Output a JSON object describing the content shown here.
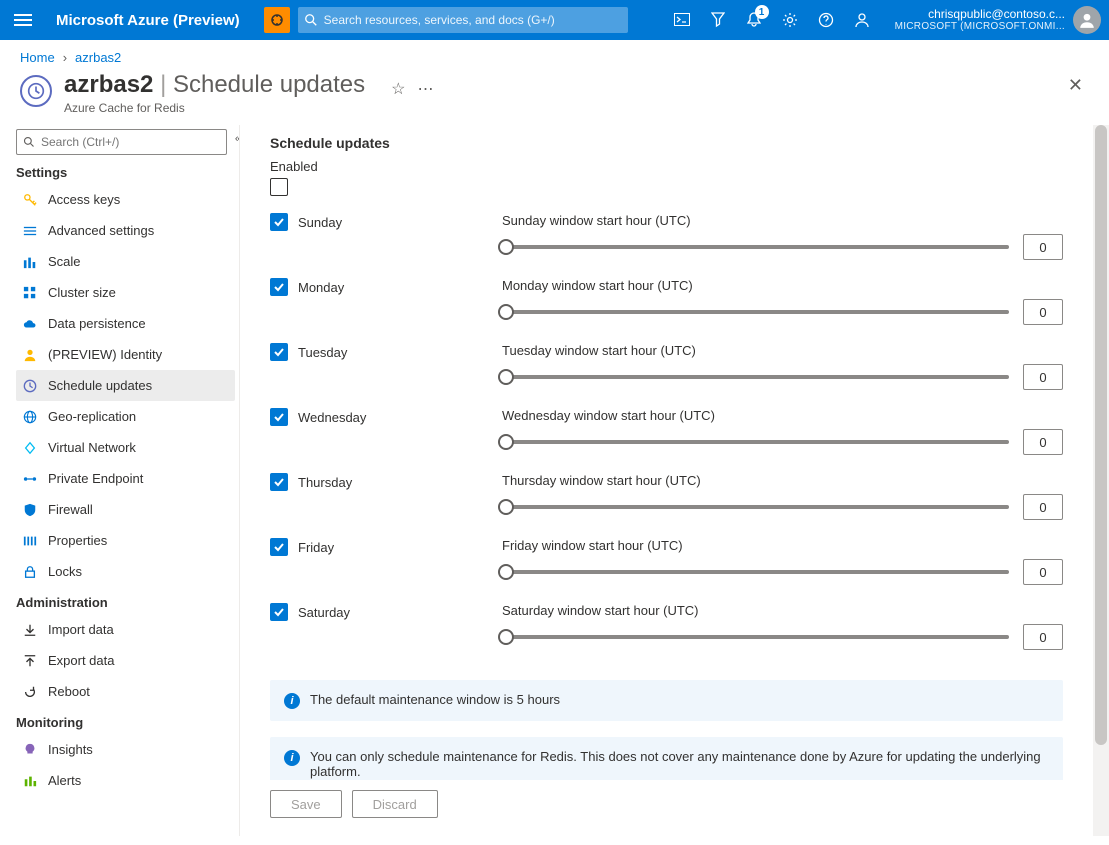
{
  "topbar": {
    "brand": "Microsoft Azure (Preview)",
    "search_placeholder": "Search resources, services, and docs (G+/)",
    "notification_count": "1",
    "account_email": "chrisqpublic@contoso.c...",
    "account_org": "MICROSOFT (MICROSOFT.ONMI..."
  },
  "breadcrumb": {
    "home": "Home",
    "resource": "azrbas2"
  },
  "header": {
    "resource_name": "azrbas2",
    "blade_title": "Schedule updates",
    "resource_type": "Azure Cache for Redis"
  },
  "sidebar": {
    "search_placeholder": "Search (Ctrl+/)",
    "groups": [
      {
        "title": "Settings",
        "items": [
          {
            "label": "Access keys",
            "icon": "key",
            "color": "#ffb900"
          },
          {
            "label": "Advanced settings",
            "icon": "sliders",
            "color": "#0078d4"
          },
          {
            "label": "Scale",
            "icon": "scale",
            "color": "#0078d4"
          },
          {
            "label": "Cluster size",
            "icon": "cluster",
            "color": "#0078d4"
          },
          {
            "label": "Data persistence",
            "icon": "cloud",
            "color": "#0078d4"
          },
          {
            "label": "(PREVIEW) Identity",
            "icon": "identity",
            "color": "#ffb900"
          },
          {
            "label": "Schedule updates",
            "icon": "clock",
            "color": "#5c6bc0",
            "selected": true
          },
          {
            "label": "Geo-replication",
            "icon": "globe",
            "color": "#0078d4"
          },
          {
            "label": "Virtual Network",
            "icon": "vnet",
            "color": "#00bcf2"
          },
          {
            "label": "Private Endpoint",
            "icon": "endpoint",
            "color": "#0078d4"
          },
          {
            "label": "Firewall",
            "icon": "shield",
            "color": "#0078d4"
          },
          {
            "label": "Properties",
            "icon": "properties",
            "color": "#0078d4"
          },
          {
            "label": "Locks",
            "icon": "lock",
            "color": "#0078d4"
          }
        ]
      },
      {
        "title": "Administration",
        "items": [
          {
            "label": "Import data",
            "icon": "download",
            "color": "#323130"
          },
          {
            "label": "Export data",
            "icon": "upload",
            "color": "#323130"
          },
          {
            "label": "Reboot",
            "icon": "reboot",
            "color": "#323130"
          }
        ]
      },
      {
        "title": "Monitoring",
        "items": [
          {
            "label": "Insights",
            "icon": "bulb",
            "color": "#8764b8"
          },
          {
            "label": "Alerts",
            "icon": "alerts",
            "color": "#5db300"
          }
        ]
      }
    ]
  },
  "content": {
    "section_title": "Schedule updates",
    "enabled_label": "Enabled",
    "enabled_checked": false,
    "days": [
      {
        "name": "Sunday",
        "label": "Sunday window start hour (UTC)",
        "value": "0",
        "checked": true
      },
      {
        "name": "Monday",
        "label": "Monday window start hour (UTC)",
        "value": "0",
        "checked": true
      },
      {
        "name": "Tuesday",
        "label": "Tuesday window start hour (UTC)",
        "value": "0",
        "checked": true
      },
      {
        "name": "Wednesday",
        "label": "Wednesday window start hour (UTC)",
        "value": "0",
        "checked": true
      },
      {
        "name": "Thursday",
        "label": "Thursday window start hour (UTC)",
        "value": "0",
        "checked": true
      },
      {
        "name": "Friday",
        "label": "Friday window start hour (UTC)",
        "value": "0",
        "checked": true
      },
      {
        "name": "Saturday",
        "label": "Saturday window start hour (UTC)",
        "value": "0",
        "checked": true
      }
    ],
    "info1": "The default maintenance window is 5 hours",
    "info2": "You can only schedule maintenance for Redis. This does not cover any maintenance done by Azure for updating the underlying platform.",
    "save_label": "Save",
    "discard_label": "Discard"
  }
}
